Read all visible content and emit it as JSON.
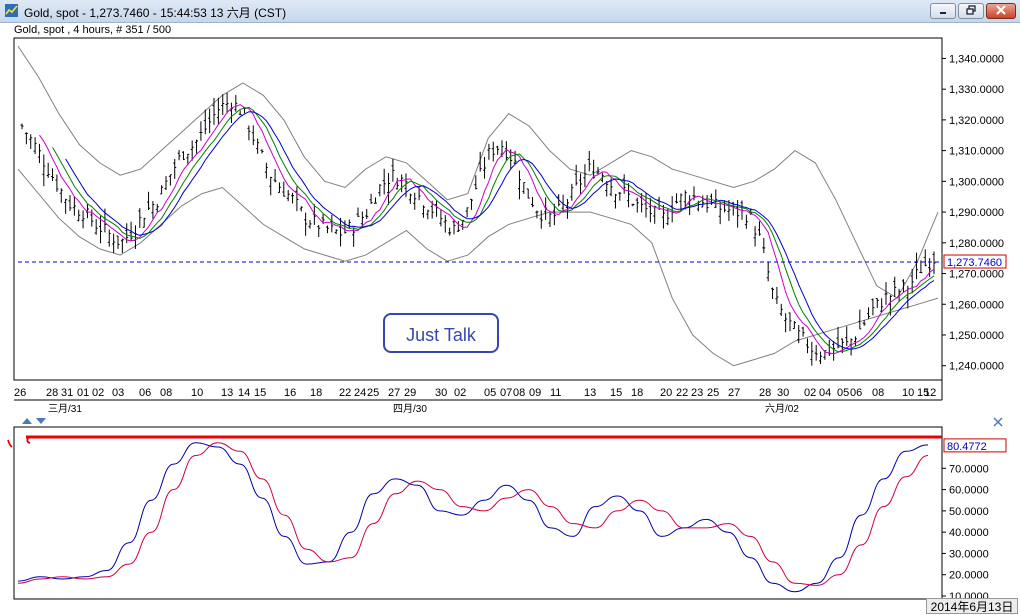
{
  "window": {
    "title": "Gold, spot - 1,273.7460 - 15:44:53  13 六月 (CST)",
    "subtitle": "Gold, spot , 4 hours, # 351 / 500"
  },
  "annotation": {
    "text": "Just Talk"
  },
  "date_tooltip": "2014年6月13日",
  "chart_data": [
    {
      "type": "candlestick",
      "ylim": [
        1236,
        1346
      ],
      "y_ticks": [
        "1,240.0000",
        "1,250.0000",
        "1,260.0000",
        "1,270.0000",
        "1,280.0000",
        "1,290.0000",
        "1,300.0000",
        "1,310.0000",
        "1,320.0000",
        "1,330.0000",
        "1,340.0000"
      ],
      "y_tick_values": [
        1240,
        1250,
        1260,
        1270,
        1280,
        1290,
        1300,
        1310,
        1320,
        1330,
        1340
      ],
      "x_ticks": [
        "26",
        "28",
        "31",
        "01",
        "02",
        "03",
        "06",
        "08",
        "10",
        "13",
        "14",
        "15",
        "16",
        "18",
        "22",
        "24",
        "25",
        "27",
        "29",
        "30",
        "02",
        "05",
        "07",
        "08",
        "09",
        "11",
        "13",
        "15",
        "18",
        "20",
        "22",
        "23",
        "25",
        "27",
        "28",
        "30",
        "02",
        "04",
        "05",
        "06",
        "08",
        "10",
        "12",
        "15"
      ],
      "month_labels": [
        "三月/31",
        "四月/30",
        "六月/02"
      ],
      "last_price": 1273.746,
      "last_price_label": "1,273.7460",
      "close_path": [
        1318,
        1312,
        1305,
        1298,
        1292,
        1290,
        1286,
        1283,
        1280,
        1284,
        1290,
        1294,
        1302,
        1309,
        1312,
        1318,
        1324,
        1326,
        1322,
        1312,
        1303,
        1298,
        1294,
        1288,
        1286,
        1284,
        1283,
        1286,
        1290,
        1298,
        1302,
        1300,
        1296,
        1292,
        1288,
        1284,
        1289,
        1300,
        1310,
        1312,
        1306,
        1296,
        1290,
        1288,
        1292,
        1298,
        1304,
        1303,
        1298,
        1296,
        1292,
        1290,
        1288,
        1293,
        1296,
        1294,
        1292,
        1291,
        1290,
        1289,
        1280,
        1262,
        1255,
        1250,
        1246,
        1244,
        1246,
        1247,
        1252,
        1258,
        1262,
        1264,
        1266,
        1272,
        1275
      ],
      "bollinger": {
        "upper": [
          1344,
          1334,
          1322,
          1312,
          1306,
          1302,
          1304,
          1310,
          1316,
          1322,
          1328,
          1332,
          1328,
          1320,
          1308,
          1300,
          1298,
          1304,
          1308,
          1306,
          1300,
          1294,
          1296,
          1314,
          1322,
          1318,
          1310,
          1304,
          1302,
          1306,
          1310,
          1308,
          1304,
          1302,
          1300,
          1298,
          1300,
          1304,
          1310,
          1306,
          1294,
          1280,
          1266,
          1262,
          1274,
          1290
        ],
        "lower": [
          1304,
          1296,
          1288,
          1282,
          1278,
          1276,
          1280,
          1286,
          1292,
          1296,
          1298,
          1292,
          1286,
          1282,
          1278,
          1276,
          1274,
          1276,
          1280,
          1284,
          1278,
          1274,
          1276,
          1282,
          1286,
          1288,
          1290,
          1290,
          1290,
          1288,
          1286,
          1280,
          1262,
          1250,
          1244,
          1240,
          1242,
          1244,
          1248,
          1250,
          1252,
          1254,
          1256,
          1258,
          1260,
          1262
        ]
      },
      "moving_averages": [
        "magenta",
        "green",
        "blue"
      ]
    },
    {
      "type": "line",
      "ylim": [
        10,
        88
      ],
      "y_ticks": [
        "10.0000",
        "20.0000",
        "30.0000",
        "40.0000",
        "50.0000",
        "60.0000",
        "70.0000"
      ],
      "y_tick_values": [
        10,
        20,
        30,
        40,
        50,
        60,
        70
      ],
      "last_value_label": "80.4772",
      "reference_level": 82,
      "series": [
        {
          "color": "#0000aa",
          "values": [
            17,
            19,
            18,
            19,
            22,
            35,
            55,
            72,
            82,
            80,
            72,
            56,
            38,
            25,
            26,
            40,
            58,
            65,
            62,
            50,
            48,
            55,
            62,
            55,
            42,
            38,
            52,
            57,
            50,
            38,
            42,
            46,
            40,
            28,
            16,
            12,
            16,
            28,
            48,
            65,
            78,
            81
          ]
        },
        {
          "color": "#cc0044",
          "values": [
            16,
            18,
            19,
            18,
            19,
            25,
            40,
            60,
            76,
            82,
            78,
            65,
            48,
            32,
            26,
            28,
            44,
            58,
            64,
            60,
            52,
            50,
            56,
            60,
            52,
            44,
            42,
            50,
            55,
            50,
            42,
            42,
            44,
            38,
            26,
            16,
            15,
            20,
            34,
            52,
            66,
            76
          ]
        }
      ]
    }
  ],
  "colors": {
    "candle": "#000000",
    "bollinger": "#808080",
    "ma_magenta": "#cc00cc",
    "ma_green": "#008000",
    "ma_blue": "#0000cc",
    "price_line": "#0000cc",
    "price_label": "#cc0000",
    "oscillator_blue": "#0000aa",
    "oscillator_red": "#cc0044",
    "reference": "#ee0000"
  },
  "icons": [
    "gold-chart-app-icon",
    "minimize-icon",
    "restore-icon",
    "close-icon",
    "scroll-up-arrow-icon",
    "scroll-down-arrow-icon",
    "panel-close-icon"
  ]
}
